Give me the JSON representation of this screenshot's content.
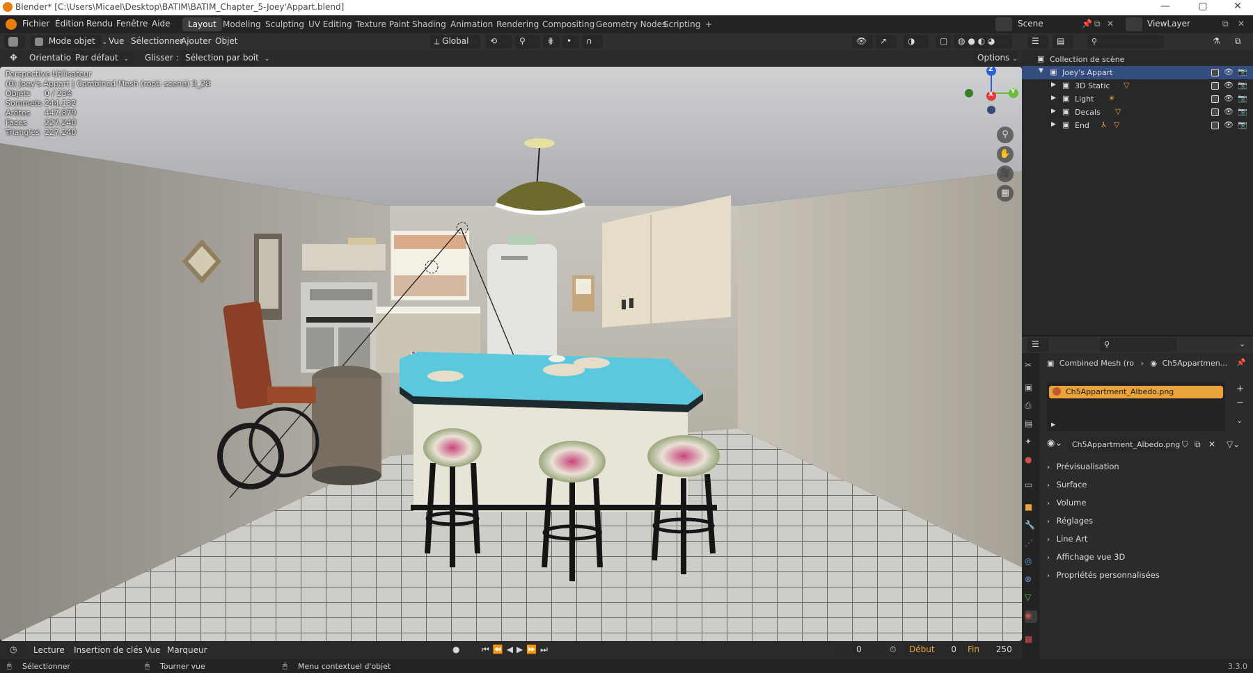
{
  "window": {
    "title": "Blender* [C:\\Users\\Micael\\Desktop\\BATIM\\BATIM_Chapter_5-Joey'Appart.blend]",
    "min": "—",
    "max": "▢",
    "close": "✕"
  },
  "menu": [
    "Fichier",
    "Édition",
    "Rendu",
    "Fenêtre",
    "Aide"
  ],
  "workspaces": [
    "Layout",
    "Modeling",
    "Sculpting",
    "UV Editing",
    "Texture Paint",
    "Shading",
    "Animation",
    "Rendering",
    "Compositing",
    "Geometry Nodes",
    "Scripting",
    "+"
  ],
  "scene": {
    "label": "Scene",
    "view_layer": "ViewLayer"
  },
  "viewport_header": {
    "mode": "Mode objet",
    "menus": [
      "Vue",
      "Sélectionner",
      "Ajouter",
      "Objet"
    ],
    "transform": "Global"
  },
  "tool_header": {
    "orientation_label": "Orientation:",
    "orientation_value": "Par défaut",
    "drag_label": "Glisser :",
    "drag_value": "Sélection par boît",
    "options": "Options"
  },
  "overlay": {
    "view_name": "Perspective Utilisateur",
    "object_info": "(0) Joey's Appart | Combined Mesh (root: scene) 3_28",
    "stats": [
      {
        "label": "Objets",
        "value": "0 / 234"
      },
      {
        "label": "Sommets",
        "value": "244,132"
      },
      {
        "label": "Arêtes",
        "value": "447,879"
      },
      {
        "label": "Faces",
        "value": "227,240"
      },
      {
        "label": "Triangles",
        "value": "227,240"
      }
    ]
  },
  "gizmo": {
    "z": "Z",
    "y": "Y",
    "x": "X"
  },
  "timeline": {
    "playback": "Lecture",
    "keying": "Insertion de clés",
    "view": "Vue",
    "marker": "Marqueur",
    "current_frame": "0",
    "start_label": "Début",
    "start": "0",
    "end_label": "Fin",
    "end": "250"
  },
  "status": {
    "select": "Sélectionner",
    "rotate": "Tourner vue",
    "context": "Menu contextuel d'objet",
    "version": "3.3.0"
  },
  "outliner": {
    "root": "Collection de scène",
    "collection": "Joey's Appart",
    "children": [
      "3D Static",
      "Light",
      "Decals",
      "End"
    ]
  },
  "properties": {
    "breadcrumb_obj": "Combined Mesh (ro",
    "breadcrumb_mat": "Ch5Appartmen...",
    "material_slot": "Ch5Appartment_Albedo.png",
    "material_name": "Ch5Appartment_Albedo.png",
    "panels": [
      "Prévisualisation",
      "Surface",
      "Volume",
      "Réglages",
      "Line Art",
      "Affichage vue 3D",
      "Propriétés personnalisées"
    ]
  },
  "colors": {
    "accent_orange": "#e8a33a",
    "selection_blue": "#334d80",
    "axis_x": "#e03a3a",
    "axis_y": "#6dbb3a",
    "axis_z": "#2e5fd6",
    "countertop": "#5cc8dd"
  }
}
